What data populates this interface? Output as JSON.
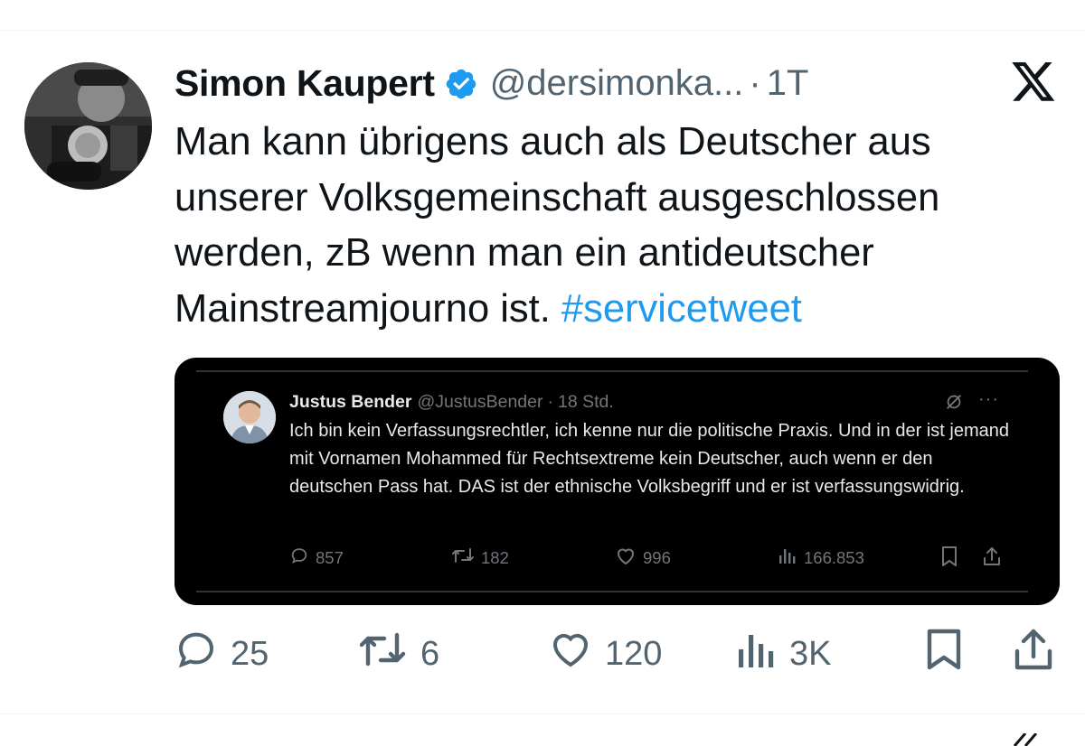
{
  "tweet": {
    "author_name": "Simon Kaupert",
    "handle": "@dersimonka...",
    "separator": "·",
    "time": "1T",
    "text_main": "Man kann übrigens auch als Deutscher aus unserer Volksgemeinschaft ausgeschlossen werden, zB wenn man ein antideutscher Mainstreamjourno ist.",
    "hashtag": "#servicetweet",
    "verified_color": "#1d9bf0",
    "link_color": "#1d9bf0",
    "actions": {
      "replies": "25",
      "retweets": "6",
      "likes": "120",
      "views": "3K"
    }
  },
  "embedded": {
    "author_name": "Justus Bender",
    "handle": "@JustusBender",
    "separator": "·",
    "time": "18 Std.",
    "more_label": "···",
    "text": "Ich bin kein Verfassungsrechtler, ich kenne nur die politische Praxis. Und in der ist jemand mit Vornamen Mohammed für Rechtsextreme kein Deutscher, auch wenn er den deutschen Pass hat. DAS ist der ethnische Volksbegriff und er ist verfassungswidrig.",
    "background": "#000000",
    "actions": {
      "replies": "857",
      "retweets": "182",
      "likes": "996",
      "views": "166.853"
    }
  },
  "icons": [
    "verified-badge-icon",
    "x-logo-icon",
    "reply-icon",
    "retweet-icon",
    "like-icon",
    "views-icon",
    "bookmark-icon",
    "share-icon",
    "grok-icon",
    "more-icon"
  ]
}
